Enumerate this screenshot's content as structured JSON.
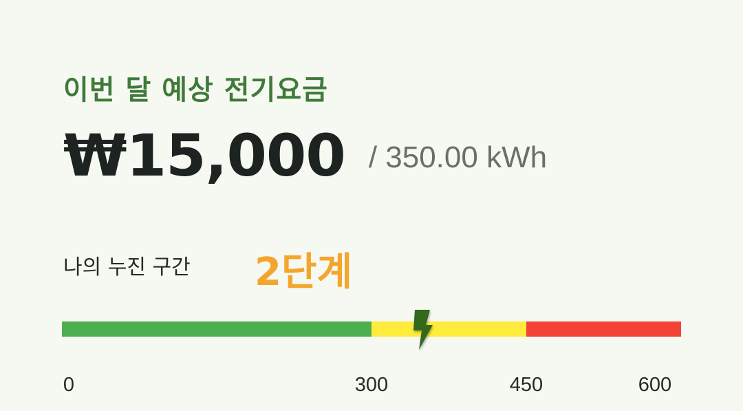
{
  "header": {
    "title": "이번 달 예상 전기요금",
    "amount": "₩15,000",
    "usage": "/ 350.00 kWh"
  },
  "tier": {
    "label": "나의 누진 구간",
    "value": "2단계"
  },
  "gauge": {
    "min": 0,
    "max": 600,
    "current": 350,
    "marker_icon": "lightning-bolt-icon",
    "segments": [
      {
        "from": 0,
        "to": 300,
        "color": "#4caf50"
      },
      {
        "from": 300,
        "to": 450,
        "color": "#ffeb3b"
      },
      {
        "from": 450,
        "to": 600,
        "color": "#f44336"
      }
    ],
    "ticks": [
      "0",
      "300",
      "450",
      "600"
    ]
  },
  "colors": {
    "title": "#3f7a3a",
    "tier_value": "#f3a62d",
    "marker": "#33691e"
  }
}
